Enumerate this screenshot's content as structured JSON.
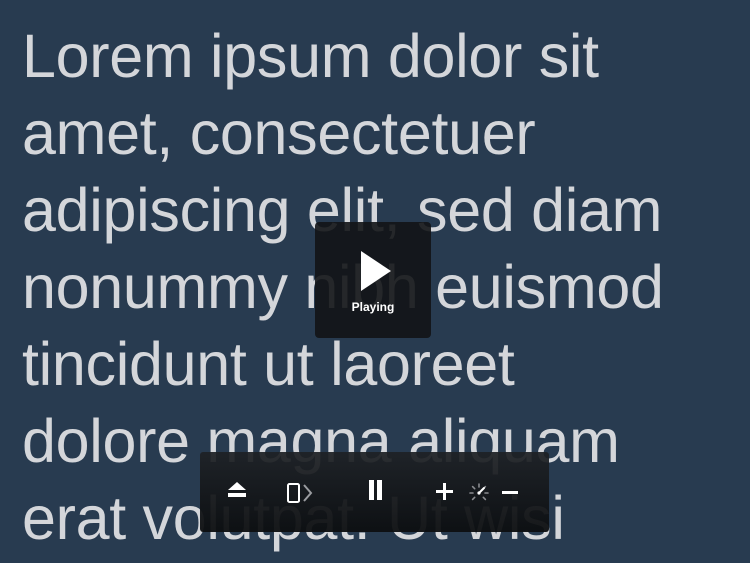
{
  "reader": {
    "text": "Lorem ipsum dolor sit\namet, consectetuer\nadipiscing elit, sed diam\nnonummy nibh euismod\ntincidunt ut laoreet\ndolore magna aliquam\nerat volutpat. Ut wisi"
  },
  "status_overlay": {
    "icon": "play-icon",
    "label": "Playing"
  },
  "toolbar": {
    "buttons": [
      "eject-icon",
      "device-arrow-icon",
      "pause-icon",
      "plus-icon",
      "speed-icon",
      "minus-icon"
    ]
  },
  "colors": {
    "background": "#283b50",
    "text": "#d4d6da",
    "overlay": "#121416",
    "icon": "#ffffff"
  }
}
